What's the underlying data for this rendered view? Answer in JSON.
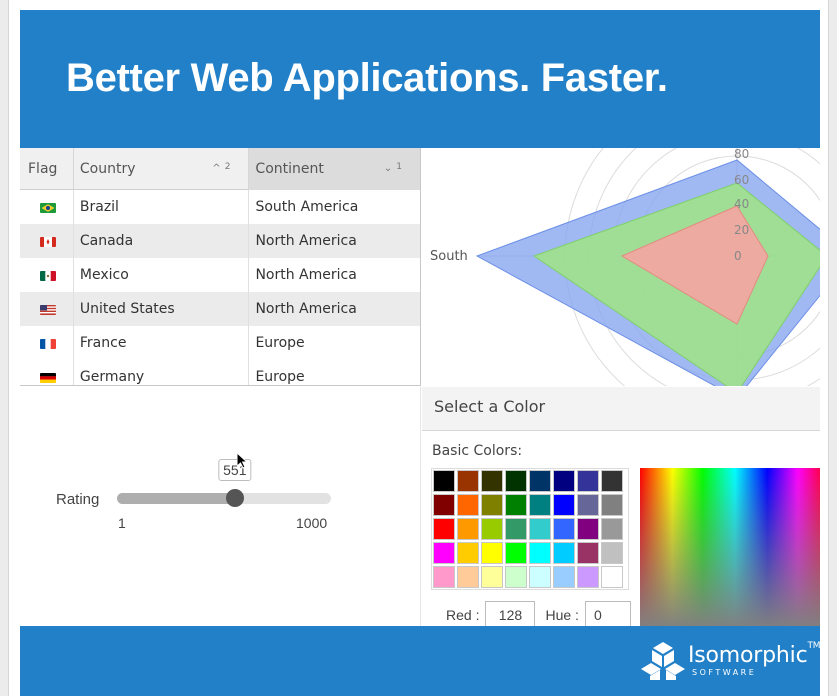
{
  "banner": {
    "headline": "Better Web Applications. Faster."
  },
  "grid": {
    "columns": {
      "flag": "Flag",
      "country": "Country",
      "continent": "Continent"
    },
    "sort": {
      "country_indicator": "^",
      "country_order": "2",
      "continent_indicator": "v",
      "continent_order": "1"
    },
    "rows": [
      {
        "flag": "brazil-flag-icon",
        "country": "Brazil",
        "continent": "South America"
      },
      {
        "flag": "canada-flag-icon",
        "country": "Canada",
        "continent": "North America"
      },
      {
        "flag": "mexico-flag-icon",
        "country": "Mexico",
        "continent": "North America"
      },
      {
        "flag": "usa-flag-icon",
        "country": "United States",
        "continent": "North America"
      },
      {
        "flag": "france-flag-icon",
        "country": "France",
        "continent": "Europe"
      },
      {
        "flag": "germany-flag-icon",
        "country": "Germany",
        "continent": "Europe"
      }
    ]
  },
  "radar": {
    "axis_label_visible": "South",
    "ticks": [
      "80",
      "60",
      "40",
      "20",
      "0"
    ],
    "colors": {
      "outer": "#8aa8f0",
      "middle": "#9ee28a",
      "inner": "#f0a7a0"
    }
  },
  "slider": {
    "label": "Rating",
    "min": 1,
    "max": 1000,
    "value": 551,
    "min_label": "1",
    "max_label": "1000",
    "value_label": "551"
  },
  "color_picker": {
    "title": "Select a Color",
    "basic_label": "Basic Colors:",
    "swatches": [
      "#000000",
      "#993300",
      "#333300",
      "#003300",
      "#003366",
      "#000080",
      "#333399",
      "#333333",
      "#800000",
      "#ff6600",
      "#808000",
      "#008000",
      "#008080",
      "#0000ff",
      "#666699",
      "#808080",
      "#ff0000",
      "#ff9900",
      "#99cc00",
      "#339966",
      "#33cccc",
      "#3366ff",
      "#800080",
      "#999999",
      "#ff00ff",
      "#ffcc00",
      "#ffff00",
      "#00ff00",
      "#00ffff",
      "#00ccff",
      "#993366",
      "#c0c0c0",
      "#ff99cc",
      "#ffcc99",
      "#ffff99",
      "#ccffcc",
      "#ccffff",
      "#99ccff",
      "#cc99ff",
      "#ffffff"
    ],
    "red_label": "Red :",
    "red_value": "128",
    "hue_label": "Hue :",
    "hue_value": "0"
  },
  "brand": {
    "name": "Isomorphic",
    "trademark": "TM",
    "subtitle": "SOFTWARE"
  }
}
